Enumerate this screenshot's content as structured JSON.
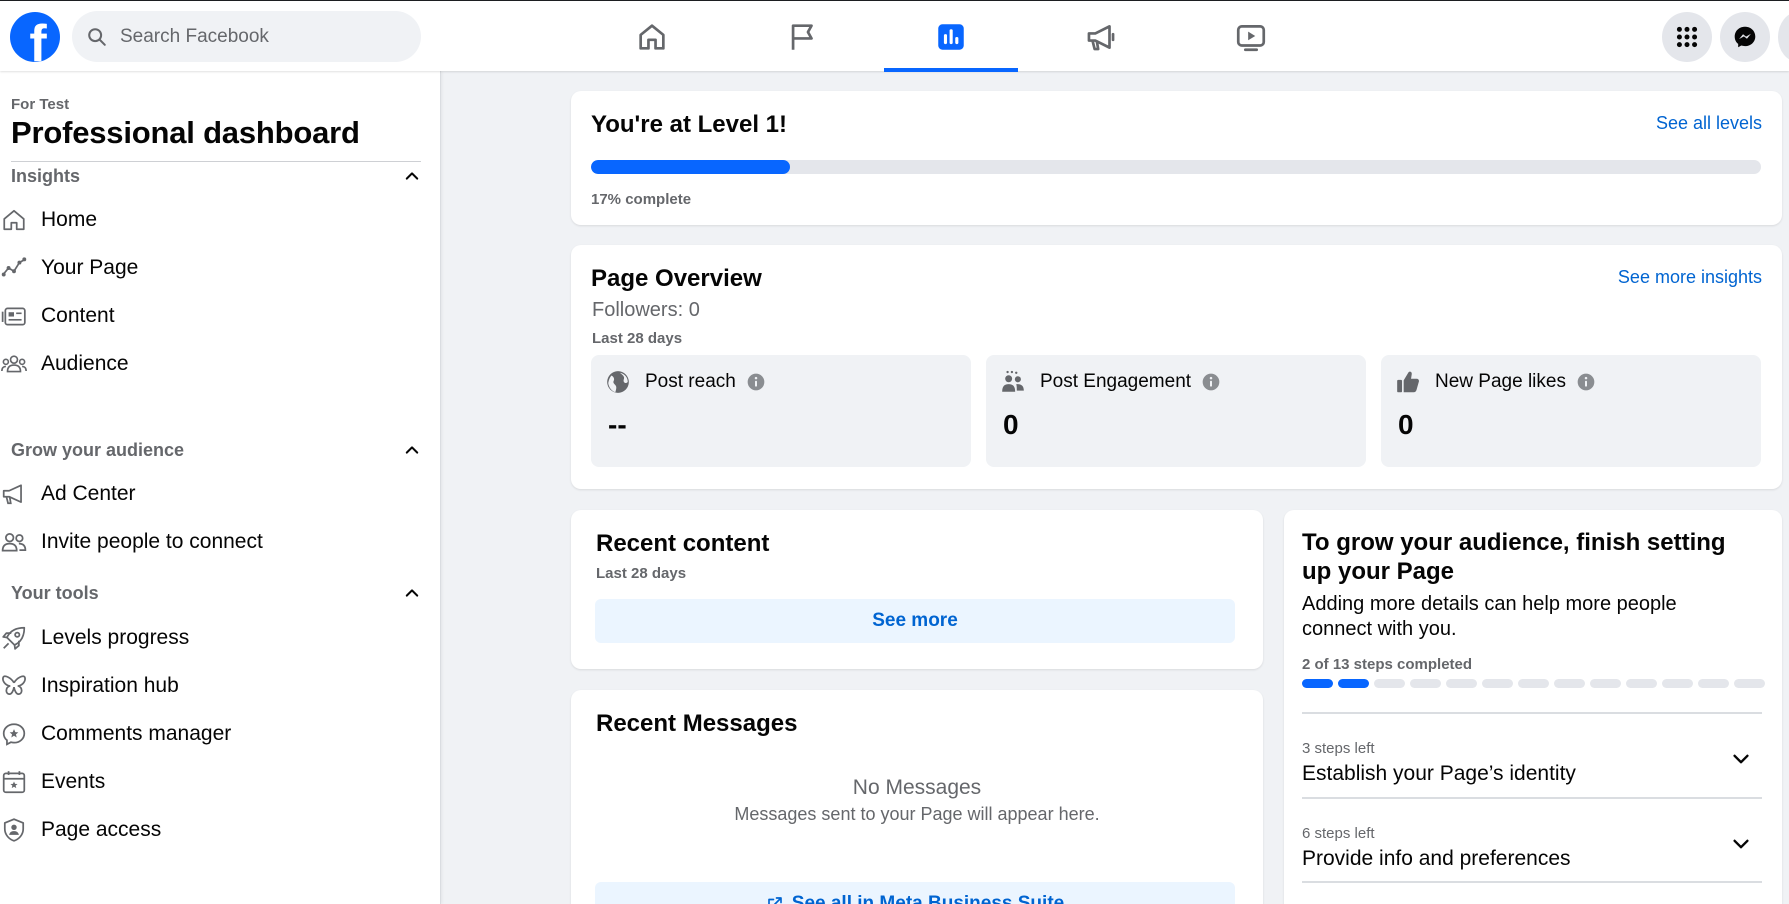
{
  "topbar": {
    "logo_letter": "f",
    "search_placeholder": "Search Facebook",
    "nav": [
      {
        "icon": "home-icon",
        "active": false
      },
      {
        "icon": "flag-icon",
        "active": false
      },
      {
        "icon": "insights-bar-icon",
        "active": true
      },
      {
        "icon": "megaphone-icon",
        "active": false
      },
      {
        "icon": "video-icon",
        "active": false
      }
    ],
    "right_buttons": [
      "menu-grid-icon",
      "messenger-icon"
    ],
    "accent_color": "#0866ff"
  },
  "sidebar": {
    "subtitle": "For Test",
    "title": "Professional dashboard",
    "sections": [
      {
        "label": "Insights",
        "items": [
          "Home",
          "Your Page",
          "Content",
          "Audience"
        ]
      },
      {
        "label": "Grow your audience",
        "items": [
          "Ad Center",
          "Invite people to connect"
        ]
      },
      {
        "label": "Your tools",
        "items": [
          "Levels progress",
          "Inspiration hub",
          "Comments manager",
          "Events",
          "Page access"
        ]
      }
    ]
  },
  "level": {
    "title": "You're at Level 1!",
    "link": "See all levels",
    "progress_percent": 17,
    "progress_text": "17% complete"
  },
  "overview": {
    "title": "Page Overview",
    "link": "See more insights",
    "followers": "Followers: 0",
    "period": "Last 28 days",
    "metrics": [
      {
        "label": "Post reach",
        "value": "--",
        "icon": "globe-icon"
      },
      {
        "label": "Post Engagement",
        "value": "0",
        "icon": "people-icon"
      },
      {
        "label": "New Page likes",
        "value": "0",
        "icon": "thumbs-up-icon"
      }
    ]
  },
  "recent_content": {
    "title": "Recent content",
    "period": "Last 28 days",
    "button": "See more"
  },
  "recent_messages": {
    "title": "Recent Messages",
    "empty_title": "No Messages",
    "empty_text": "Messages sent to your Page will appear here.",
    "link": "See all in Meta Business Suite"
  },
  "grow": {
    "title": "To grow your audience, finish setting up your Page",
    "description": "Adding more details can help more people connect with you.",
    "steps_text": "2 of 13 steps completed",
    "steps_done": 2,
    "steps_total": 13,
    "rows": [
      {
        "small": "3 steps left",
        "label": "Establish your Page’s identity"
      },
      {
        "small": "6 steps left",
        "label": "Provide info and preferences"
      }
    ]
  }
}
